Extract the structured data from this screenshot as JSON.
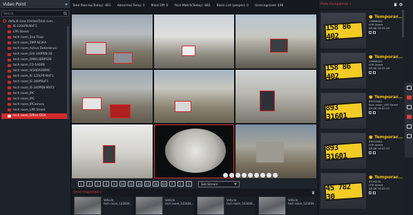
{
  "left_panel": {
    "title": "Video Point",
    "search_placeholder": "Search",
    "root_label": "default area (Online/Total num...",
    "items": [
      {
        "label": "IE-120LPR-NVF1"
      },
      {
        "label": "LPR Street"
      },
      {
        "label": "tech room_2nd Floor"
      },
      {
        "label": "tech room_5MP NCIAA"
      },
      {
        "label": "tech room_Active Deterrence"
      },
      {
        "label": "tech room_DAI 340PEN-28"
      },
      {
        "label": "tech room_DM4L5BBPS28"
      },
      {
        "label": "tech room_FD-160IPE"
      },
      {
        "label": "tech room_HI340AOWMC"
      },
      {
        "label": "tech room_IE-120LPR-NVF1"
      },
      {
        "label": "tech room_IE-340PSVF1"
      },
      {
        "label": "tech room_IE-340PEN-MVF2"
      },
      {
        "label": "tech room_IPC"
      },
      {
        "label": "tech room_IPC"
      },
      {
        "label": "tech room_IPCamera"
      },
      {
        "label": "tech room_LPR Street"
      },
      {
        "label": "tech room_Office DDA",
        "selected": true
      }
    ]
  },
  "stats": {
    "pass_by": "Total Pass-by(Today): 661",
    "abnormal_temp": "Abnormal Temp: 0",
    "mask_off": "Mask Off: 0",
    "face_match": "Face Match(Today): 682",
    "block_list": "Block List (people): 0",
    "unrecognized": "Unrecognized: 496"
  },
  "toolbar": {
    "buttons": [
      "1",
      "4",
      "6",
      "8",
      "9",
      "10",
      "13",
      "16",
      "25",
      "36",
      "64",
      "F",
      "C",
      "S"
    ],
    "stream_label": "Sub Stream"
  },
  "smart_inspection": {
    "title": "Smart Inspection »",
    "cards": [
      {
        "line1": "Vehicle",
        "line2": "tech room_143404..."
      },
      {
        "line1": "Vehicle",
        "line2": "tech room_143404..."
      },
      {
        "line1": "Vehicle",
        "line2": "tech room_143404..."
      },
      {
        "line1": "Vehicle",
        "line2": "tech room_143404..."
      }
    ]
  },
  "plate_panel": {
    "title": "Plate Comparison »",
    "cards": [
      {
        "plate": "158 86 402",
        "title": "Temporar...",
        "id": "15886402",
        "location": "LPR Street",
        "time": "08-08 16:42:26"
      },
      {
        "plate": "158 86 402",
        "title": "Temporar...",
        "id": "15886402",
        "location": "LPR Street",
        "time": "08-08 16:42:26"
      },
      {
        "plate": "893 31601",
        "title": "Temporar...",
        "id": "89331601",
        "location": "tech room_LPR Street",
        "time": "08-08 16:42:25"
      },
      {
        "plate": "893 31601",
        "title": "Temporar...",
        "id": "89331601",
        "location": "LPR Street",
        "time": "08-08 16:42:25"
      },
      {
        "plate": "45 782 30",
        "title": "Temporar...",
        "id": "4578230",
        "location": "LPR Street",
        "time": "08-08 16:42:22"
      }
    ]
  },
  "colors": {
    "accent_red": "#e03a3a",
    "plate_yellow": "#f2cc25",
    "title_yellow": "#f0c419"
  }
}
